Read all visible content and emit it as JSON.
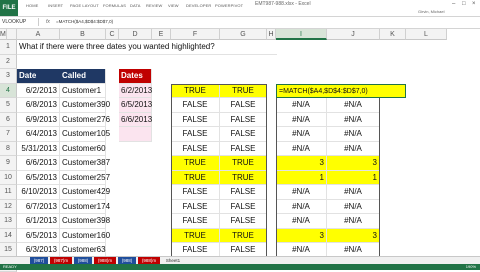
{
  "ribbon": {
    "file": "FILE",
    "tabs": [
      "HOME",
      "INSERT",
      "PAGE LAYOUT",
      "FORMULAS",
      "DATA",
      "REVIEW",
      "VIEW",
      "DEVELOPER",
      "POWERPIVOT"
    ],
    "title": "EMT987-988.xlsx - Excel",
    "user": "Girvin, Michael"
  },
  "formula_bar": {
    "name_box": "VLOOKUP",
    "fx": "fx",
    "formula": "=MATCH($A4,$D$4:$D$7,0)"
  },
  "columns": [
    "A",
    "B",
    "C",
    "D",
    "E",
    "F",
    "G",
    "H",
    "I",
    "J",
    "K",
    "L",
    "M"
  ],
  "selected_column": "I",
  "rows": [
    "1",
    "2",
    "3",
    "4",
    "5",
    "6",
    "7",
    "8",
    "9",
    "10",
    "11",
    "12",
    "13",
    "14",
    "15",
    "16"
  ],
  "selected_row": "4",
  "question": "What if there were three dates you wanted highlighted?",
  "headers": {
    "date": "Date",
    "called": "Called",
    "dates": "Dates"
  },
  "table": [
    {
      "date": "6/2/2013",
      "called": "Customer1"
    },
    {
      "date": "6/8/2013",
      "called": "Customer390"
    },
    {
      "date": "6/9/2013",
      "called": "Customer276"
    },
    {
      "date": "6/4/2013",
      "called": "Customer105"
    },
    {
      "date": "5/31/2013",
      "called": "Customer60"
    },
    {
      "date": "6/6/2013",
      "called": "Customer387"
    },
    {
      "date": "6/5/2013",
      "called": "Customer257"
    },
    {
      "date": "6/10/2013",
      "called": "Customer429"
    },
    {
      "date": "6/7/2013",
      "called": "Customer174"
    },
    {
      "date": "6/1/2013",
      "called": "Customer398"
    },
    {
      "date": "6/5/2013",
      "called": "Customer160"
    },
    {
      "date": "6/3/2013",
      "called": "Customer63"
    }
  ],
  "dates_list": [
    "6/2/2013",
    "6/5/2013",
    "6/6/2013"
  ],
  "bool_pairs": [
    [
      "TRUE",
      "TRUE"
    ],
    [
      "FALSE",
      "FALSE"
    ],
    [
      "FALSE",
      "FALSE"
    ],
    [
      "FALSE",
      "FALSE"
    ],
    [
      "FALSE",
      "FALSE"
    ],
    [
      "TRUE",
      "TRUE"
    ],
    [
      "TRUE",
      "TRUE"
    ],
    [
      "FALSE",
      "FALSE"
    ],
    [
      "FALSE",
      "FALSE"
    ],
    [
      "FALSE",
      "FALSE"
    ],
    [
      "TRUE",
      "TRUE"
    ],
    [
      "FALSE",
      "FALSE"
    ]
  ],
  "match_edit": "=MATCH($A4,$D$4:$D$7,0)",
  "match_pairs": [
    [
      "",
      "1"
    ],
    [
      "#N/A",
      "#N/A"
    ],
    [
      "#N/A",
      "#N/A"
    ],
    [
      "#N/A",
      "#N/A"
    ],
    [
      "#N/A",
      "#N/A"
    ],
    [
      "3",
      "3"
    ],
    [
      "1",
      "1"
    ],
    [
      "#N/A",
      "#N/A"
    ],
    [
      "#N/A",
      "#N/A"
    ],
    [
      "#N/A",
      "#N/A"
    ],
    [
      "3",
      "3"
    ],
    [
      "#N/A",
      "#N/A"
    ]
  ],
  "sheet_tabs": [
    {
      "label": "(987)",
      "color": "#1f4e9c"
    },
    {
      "label": "(987)m",
      "color": "#c00000"
    },
    {
      "label": "(988)",
      "color": "#1f4e9c"
    },
    {
      "label": "(988)m",
      "color": "#c00000"
    },
    {
      "label": "(988)",
      "color": "#1f4e9c"
    },
    {
      "label": "(988)m",
      "color": "#c00000"
    },
    {
      "label": "Sheet1",
      "color": "#f0f0f0"
    }
  ],
  "status": {
    "ready": "READY",
    "zoom": "190%"
  },
  "colors": {
    "excel_green": "#217346",
    "header_blue": "#1f3864",
    "header_red": "#c00000",
    "highlight": "#ffff00",
    "pink": "#fbe4ef"
  }
}
